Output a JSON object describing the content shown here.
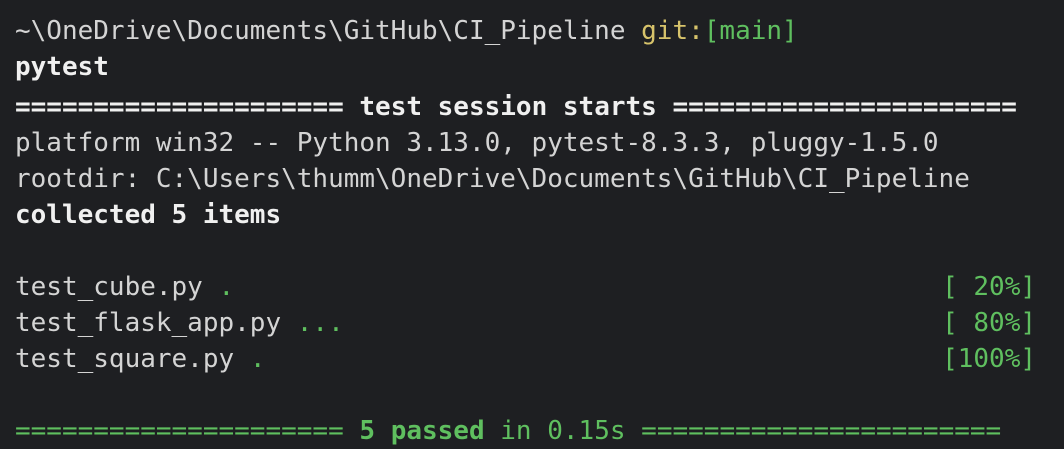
{
  "prompt": {
    "path": "~\\OneDrive\\Documents\\GitHub\\CI_Pipeline",
    "git_label": "git:",
    "branch": "[main]"
  },
  "command": "pytest",
  "session_header": {
    "left_rule": "=====================",
    "title": "test session starts",
    "right_rule": "======================"
  },
  "platform_line": "platform win32 -- Python 3.13.0, pytest-8.3.3, pluggy-1.5.0",
  "rootdir_line": "rootdir: C:\\Users\\thumm\\OneDrive\\Documents\\GitHub\\CI_Pipeline",
  "collected_line": "collected 5 items",
  "results": [
    {
      "file": "test_cube.py",
      "dots": ".",
      "progress": "[ 20%]"
    },
    {
      "file": "test_flask_app.py",
      "dots": "...",
      "progress": "[ 80%]"
    },
    {
      "file": "test_square.py",
      "dots": ".",
      "progress": "[100%]"
    }
  ],
  "summary": {
    "left_rule": "=====================",
    "passed": "5 passed",
    "duration": "in 0.15s",
    "right_rule": "======================="
  },
  "colors": {
    "background": "#1e1f22",
    "text": "#d4d4d4",
    "green": "#5fbf5f",
    "yellow": "#d7c36b"
  }
}
